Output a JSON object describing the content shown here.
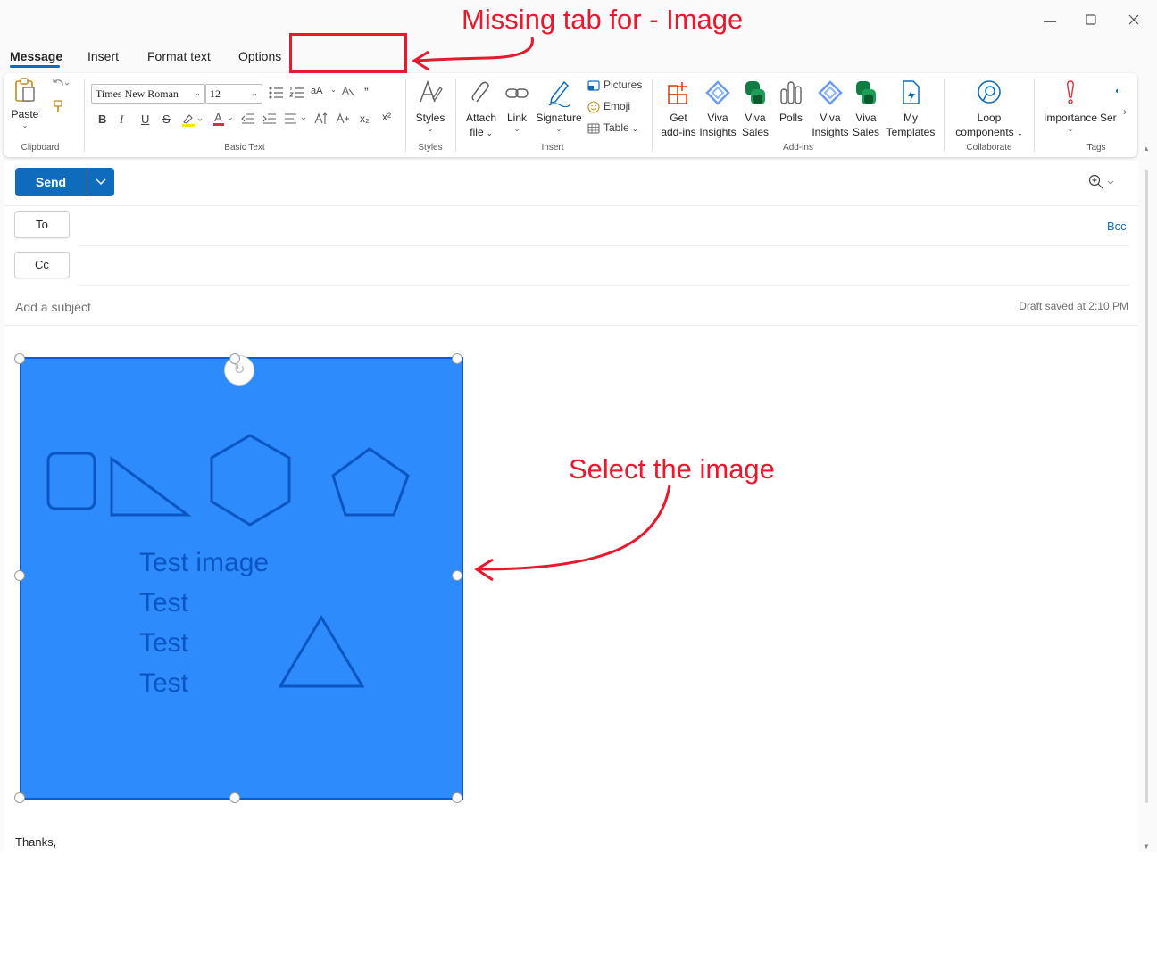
{
  "annotations": {
    "missing_tab": "Missing tab for - Image",
    "select_image": "Select the image"
  },
  "window": {
    "minimize_icon": "minimize-icon",
    "maximize_icon": "maximize-icon",
    "close_icon": "close-icon"
  },
  "tabs": [
    {
      "label": "Message",
      "active": true
    },
    {
      "label": "Insert"
    },
    {
      "label": "Format text"
    },
    {
      "label": "Options"
    }
  ],
  "ribbon": {
    "clipboard": {
      "paste": "Paste",
      "group": "Clipboard"
    },
    "basic_text": {
      "font_name": "Times New Roman",
      "font_size": "12",
      "group": "Basic Text",
      "bold": "B",
      "italic": "I",
      "underline": "U",
      "strike": "S",
      "subscript": "x₂",
      "superscript": "x²",
      "font_size_label": "aA"
    },
    "styles": {
      "label": "Styles",
      "group": "Styles"
    },
    "insert": {
      "attach_file": [
        "Attach",
        "file"
      ],
      "link": "Link",
      "signature": "Signature",
      "pictures": "Pictures",
      "emoji": "Emoji",
      "table": "Table",
      "group": "Insert"
    },
    "addins": {
      "get_addins": [
        "Get",
        "add-ins"
      ],
      "viva_insights_1": [
        "Viva",
        "Insights"
      ],
      "viva_sales_1": [
        "Viva",
        "Sales"
      ],
      "polls": "Polls",
      "viva_insights_2": [
        "Viva",
        "Insights"
      ],
      "viva_sales_2": [
        "Viva",
        "Sales"
      ],
      "my_templates": [
        "My",
        "Templates"
      ],
      "group": "Add-ins"
    },
    "collaborate": {
      "loop": [
        "Loop",
        "components"
      ],
      "group": "Collaborate"
    },
    "tags": {
      "importance": "Importance",
      "sen": "Ser",
      "group": "Tags"
    }
  },
  "compose": {
    "send": "Send",
    "to": "To",
    "cc": "Cc",
    "bcc": "Bcc",
    "subject_placeholder": "Add a subject",
    "draft_status": "Draft saved at 2:10 PM",
    "image_text": [
      "Test image",
      "Test",
      "Test",
      "Test"
    ],
    "signoff": "Thanks,"
  },
  "colors": {
    "accent": "#0f6cbd",
    "annotation": "#e8192c",
    "image_fill": "#2e8bfc",
    "image_stroke": "#0a55c2"
  }
}
